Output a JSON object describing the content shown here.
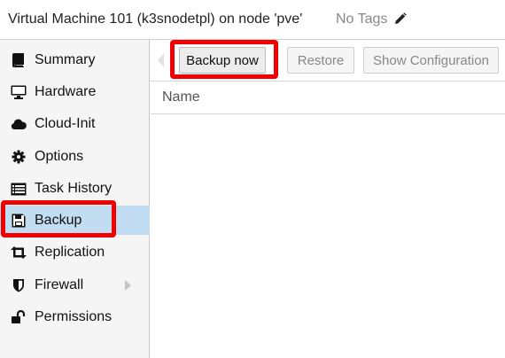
{
  "header": {
    "title": "Virtual Machine 101 (k3snodetpl) on node 'pve'",
    "tags_label": "No Tags"
  },
  "sidebar": {
    "active_item": "Backup",
    "items": [
      {
        "label": "Summary",
        "icon": "book-icon"
      },
      {
        "label": "Hardware",
        "icon": "desktop-icon"
      },
      {
        "label": "Cloud-Init",
        "icon": "cloud-icon"
      },
      {
        "label": "Options",
        "icon": "gear-icon"
      },
      {
        "label": "Task History",
        "icon": "list-icon"
      },
      {
        "label": "Backup",
        "icon": "floppy-disk-icon"
      },
      {
        "label": "Replication",
        "icon": "retweet-icon"
      },
      {
        "label": "Firewall",
        "icon": "shield-icon"
      },
      {
        "label": "Permissions",
        "icon": "unlock-icon"
      }
    ]
  },
  "toolbar": {
    "backup_now_label": "Backup now",
    "restore_label": "Restore",
    "show_config_label": "Show Configuration"
  },
  "grid": {
    "columns": [
      "Name"
    ]
  },
  "colors": {
    "active_item_bg": "#c2ddf2",
    "highlight": "#f00000"
  }
}
